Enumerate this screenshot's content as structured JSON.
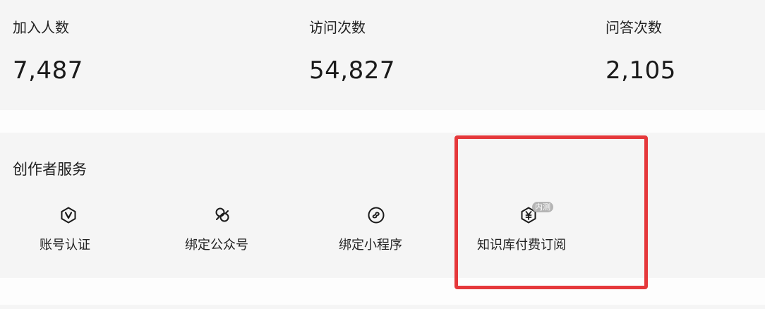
{
  "stats": [
    {
      "label": "加入人数",
      "value": "7,487"
    },
    {
      "label": "访问次数",
      "value": "54,827"
    },
    {
      "label": "问答次数",
      "value": "2,105"
    }
  ],
  "services": {
    "title": "创作者服务",
    "items": [
      {
        "label": "账号认证",
        "icon": "verified-v-icon"
      },
      {
        "label": "绑定公众号",
        "icon": "wechat-official-account-icon"
      },
      {
        "label": "绑定小程序",
        "icon": "mini-program-icon"
      },
      {
        "label": "知识库付费订阅",
        "icon": "yuan-subscription-icon",
        "badge": "内测"
      }
    ]
  },
  "colors": {
    "highlight": "#e5383b",
    "badge_bg": "#b4b4b4",
    "card_bg": "#f5f5f5"
  }
}
